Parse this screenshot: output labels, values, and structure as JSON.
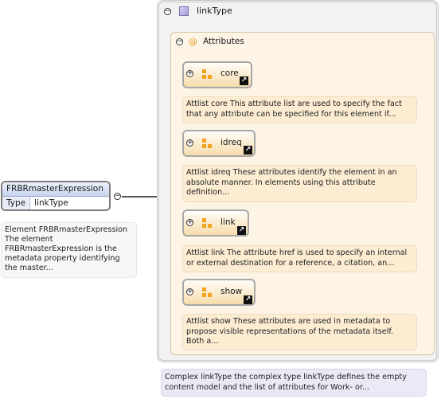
{
  "element": {
    "name": "FRBRmasterExpression",
    "type_key": "Type",
    "type_value": "linkType",
    "annotation": "Element FRBRmasterExpression The element FRBRmasterExpression is the metadata property identifying the master..."
  },
  "complex_type": {
    "name": "linkType",
    "annotation": "Complex linkType the complex type linkType defines the empty content model and the list of attributes for Work- or..."
  },
  "attributes": {
    "label": "Attributes",
    "groups": [
      {
        "name": "core",
        "description": "Attlist core This attribute list are used to specify the fact that any attribute can be specified for this element if..."
      },
      {
        "name": "idreq",
        "description": "Attlist idreq These attributes identify the element in an absolute manner. In elements using this attribute definition..."
      },
      {
        "name": "link",
        "description": "Attlist link The attribute href is used to specify an internal or external destination for a reference, a citation, an..."
      },
      {
        "name": "show",
        "description": "Attlist show These attributes are used in metadata to propose visible representations of the metadata itself. Both a..."
      }
    ]
  },
  "symbols": {
    "collapse": "−",
    "expand": "+",
    "attribute": "@",
    "link_arrow": "↗"
  },
  "colors": {
    "element_header": "#c6d3ef",
    "attribute_group": "#f6dcab",
    "complex_type_annotation": "#ece9f7",
    "accent_orange": "#f2a21c"
  }
}
